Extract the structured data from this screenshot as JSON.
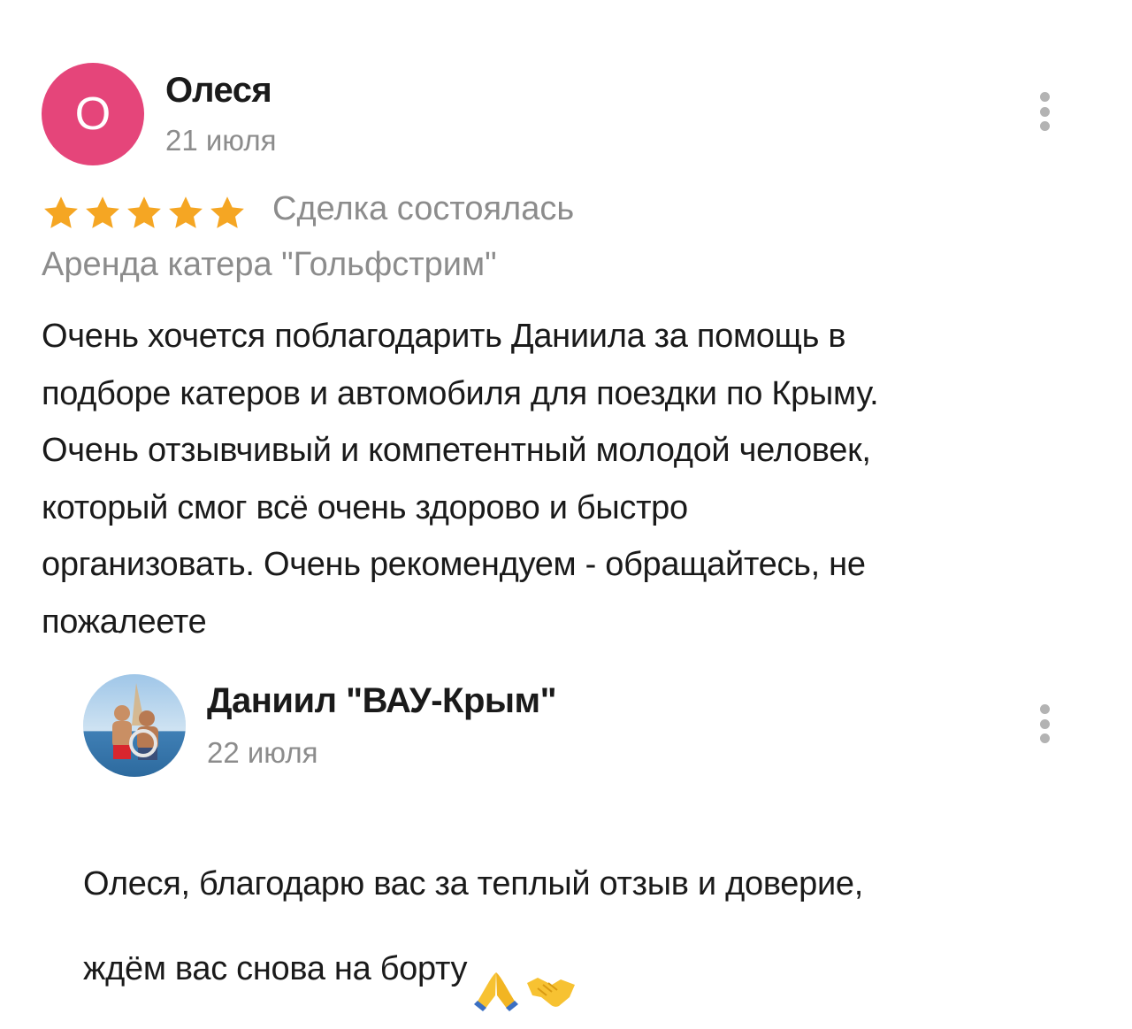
{
  "review": {
    "avatar_letter": "О",
    "avatar_color": "#e5457a",
    "author": "Олеся",
    "date": "21 июля",
    "rating": 5,
    "rating_max": 5,
    "star_color": "#f5a623",
    "deal_status": "Сделка состоялась",
    "item": "Аренда катера \"Гольфстрим\"",
    "text": "Очень хочется поблагодарить Даниила за помощь в\nподборе катеров и автомобиля для поездки по Крыму.\nОчень отзывчивый и компетентный молодой человек,\nкоторый смог всё очень здорово и быстро\nорганизовать. Очень рекомендуем - обращайтесь, не\nпожалеете",
    "more_icon": "more-vertical-icon"
  },
  "reply": {
    "author": "Даниил \"ВАУ-Крым\"",
    "date": "22 июля",
    "text": "Олеся, благодарю вас за теплый отзыв и доверие,\nждём вас снова на борту",
    "emojis": [
      "folded-hands-icon",
      "handshake-icon"
    ],
    "more_icon": "more-vertical-icon"
  }
}
